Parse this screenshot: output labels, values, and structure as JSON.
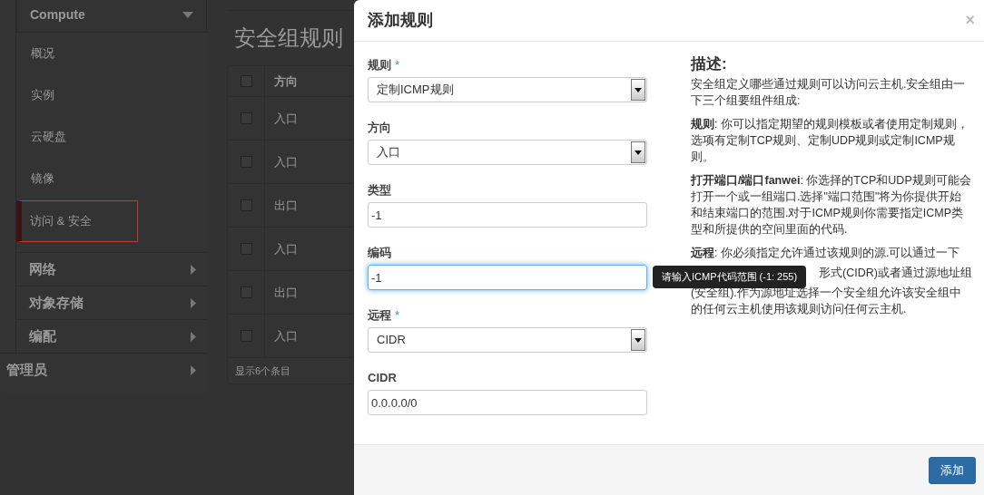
{
  "sidebar": {
    "section": {
      "label": "Compute",
      "expanded": true,
      "items": [
        {
          "label": "概况",
          "selected": false
        },
        {
          "label": "实例",
          "selected": false
        },
        {
          "label": "云硬盘",
          "selected": false
        },
        {
          "label": "镜像",
          "selected": false
        },
        {
          "label": "访问 & 安全",
          "selected": true
        }
      ]
    },
    "groups": [
      {
        "label": "网络",
        "expanded": false
      },
      {
        "label": "对象存储",
        "expanded": false
      },
      {
        "label": "编配",
        "expanded": false
      }
    ],
    "admin": {
      "label": "管理员",
      "expanded": false
    }
  },
  "page": {
    "title": "安全组规则",
    "table": {
      "columns": [
        "方向"
      ],
      "header_checked": false,
      "rows": [
        {
          "direction": "入口",
          "checked": false
        },
        {
          "direction": "入口",
          "checked": false
        },
        {
          "direction": "出口",
          "checked": false
        },
        {
          "direction": "入口",
          "checked": false
        },
        {
          "direction": "出口",
          "checked": false
        },
        {
          "direction": "入口",
          "checked": false
        }
      ],
      "footer": "显示6个条目"
    }
  },
  "modal": {
    "title": "添加规则",
    "close": "×",
    "fields": [
      {
        "label": "规则",
        "marker": "*",
        "kind": "select",
        "value": "定制ICMP规则",
        "focused": false
      },
      {
        "label": "方向",
        "kind": "select",
        "value": "入口",
        "focused": false
      },
      {
        "label": "类型",
        "kind": "input",
        "value": "-1",
        "focused": false
      },
      {
        "label": "编码",
        "kind": "input",
        "value": "-1",
        "focused": true,
        "tooltip": "请输入ICMP代码范围 (-1: 255)"
      },
      {
        "label": "远程",
        "marker": "*",
        "kind": "select",
        "value": "CIDR",
        "focused": false
      },
      {
        "label": "CIDR",
        "kind": "input",
        "value": "0.0.0.0/0",
        "focused": false
      }
    ],
    "description": {
      "title": "描述:",
      "paragraphs": [
        {
          "text": "安全组定义哪些通过规则可以访问云主机.安全组由一下三个组要组件组成:"
        },
        {
          "text": "**规则**: 你可以指定期望的规则模板或者使用定制规则，选项有定制TCP规则、定制UDP规则或定制ICMP规则。"
        },
        {
          "text": "**打开端口/端口fanwei**: 你选择的TCP和UDP规则可能会打开一个或一组端口.选择\"端口范围\"将为你提供开始和结束端口的范围.对于ICMP规则你需要指定ICMP类型和所提供的空间里面的代码."
        },
        {
          "text": "**远程**: 你必须指定允许通过该规则的源.可以通过一下",
          "after_tooltip": "形式(CIDR)或者通过源地址组",
          "rest": "(安全组).作为源地址选择一个安全组允许该安全组中的任何云主机使用该规则访问任何云主机."
        }
      ]
    },
    "buttons": [
      {
        "label": "添加",
        "kind": "primary"
      }
    ]
  }
}
